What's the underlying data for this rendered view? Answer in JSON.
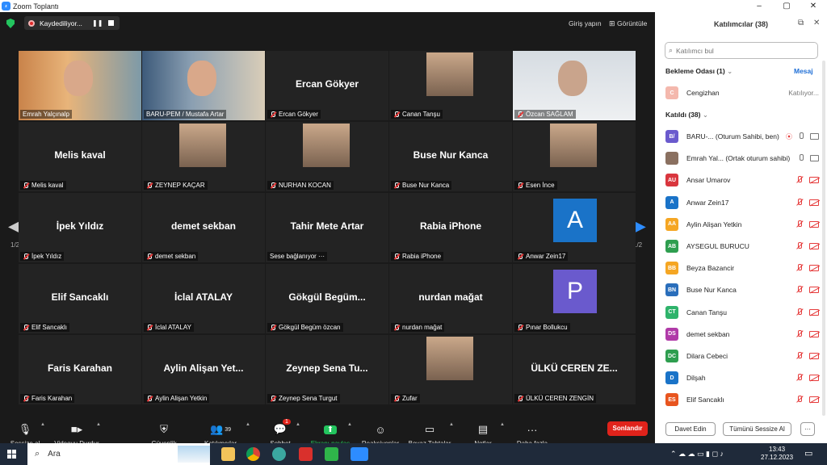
{
  "window": {
    "title": "Zoom Toplantı"
  },
  "meeting": {
    "recording_label": "Kaydediliyor...",
    "signin": "Giriş yapın",
    "view": "Görüntüle",
    "page_left": "1/2",
    "page_right": "1/2"
  },
  "tiles": [
    {
      "name": "Emrah Yalçınalp",
      "big": "",
      "type": "photo",
      "muted": false,
      "active": true
    },
    {
      "name": "BARU-PEM / Mustafa Artar",
      "big": "",
      "type": "photo",
      "muted": false
    },
    {
      "name": "Ercan Gökyer",
      "big": "Ercan Gökyer",
      "type": "name",
      "muted": true
    },
    {
      "name": "Canan Tanşu",
      "big": "",
      "type": "pic",
      "muted": true
    },
    {
      "name": "Özcan SAĞLAM",
      "big": "",
      "type": "photo",
      "muted": true
    },
    {
      "name": "Melis kaval",
      "big": "Melis kaval",
      "type": "name",
      "muted": true
    },
    {
      "name": "ZEYNEP KAÇAR",
      "big": "",
      "type": "pic",
      "muted": true
    },
    {
      "name": "NURHAN KOCAN",
      "big": "",
      "type": "pic",
      "muted": true
    },
    {
      "name": "Buse Nur Kanca",
      "big": "Buse Nur Kanca",
      "type": "name",
      "muted": true
    },
    {
      "name": "Esen İnce",
      "big": "",
      "type": "pic",
      "muted": true
    },
    {
      "name": "İpek Yıldız",
      "big": "İpek Yıldız",
      "type": "name",
      "muted": true
    },
    {
      "name": "demet sekban",
      "big": "demet sekban",
      "type": "name",
      "muted": true
    },
    {
      "name": "Sese bağlanıyor ···",
      "big": "Tahir Mete Artar",
      "type": "name",
      "muted": false
    },
    {
      "name": "Rabia iPhone",
      "big": "Rabia iPhone",
      "type": "name",
      "muted": true
    },
    {
      "name": "Anwar Zein17",
      "big": "A",
      "type": "avatar",
      "muted": true,
      "color": "#1a73c8"
    },
    {
      "name": "Elif Sancaklı",
      "big": "Elif Sancaklı",
      "type": "name",
      "muted": true
    },
    {
      "name": "İclal ATALAY",
      "big": "İclal ATALAY",
      "type": "name",
      "muted": true
    },
    {
      "name": "Gökgül Begüm özcan",
      "big": "Gökgül Begüm...",
      "type": "name",
      "muted": true
    },
    {
      "name": "nurdan mağat",
      "big": "nurdan mağat",
      "type": "name",
      "muted": true
    },
    {
      "name": "Pınar Bollukcu",
      "big": "P",
      "type": "avatar",
      "muted": true,
      "color": "#6a5acd"
    },
    {
      "name": "Faris Karahan",
      "big": "Faris Karahan",
      "type": "name",
      "muted": true
    },
    {
      "name": "Aylin Alişan Yetkin",
      "big": "Aylin Alişan Yet...",
      "type": "name",
      "muted": true
    },
    {
      "name": "Zeynep Sena Turgut",
      "big": "Zeynep Sena Tu...",
      "type": "name",
      "muted": true
    },
    {
      "name": "Zufar",
      "big": "",
      "type": "pic",
      "muted": true
    },
    {
      "name": "ÜLKÜ CEREN ZENGİN",
      "big": "ÜLKÜ CEREN ZE...",
      "type": "name",
      "muted": true
    }
  ],
  "toolbar": {
    "mute": "Sessize al",
    "video": "Videoyu Durdur",
    "security": "Güvenlik",
    "participants": "Katılımcılar",
    "participants_count": "39",
    "chat": "Sohbet",
    "chat_badge": "1",
    "share": "Ekranı paylaş",
    "reactions": "Reaksiyonlar",
    "whiteboard": "Beyaz Tahtalar",
    "notes": "Notlar",
    "more": "Daha fazla",
    "end": "Sonlandır"
  },
  "panel": {
    "title": "Katılımcılar (38)",
    "search_placeholder": "Katılımcı bul",
    "waiting_title": "Bekleme Odası (1)",
    "waiting_action": "Mesaj",
    "waiting": [
      {
        "initial": "C",
        "name": "Cengizhan",
        "status": "Katılıyor...",
        "color": "#f4b8ad"
      }
    ],
    "joined_title": "Katıldı (38)",
    "participants": [
      {
        "initial": "B/",
        "name": "BARU-... (Oturum Sahibi, ben)",
        "color": "#6a5acd",
        "muted": false
      },
      {
        "initial": "",
        "name": "Emrah Yal... (Ortak oturum sahibi)",
        "color": "#8a7060",
        "muted": false
      },
      {
        "initial": "AU",
        "name": "Ansar Umarov",
        "color": "#d9363e",
        "muted": true
      },
      {
        "initial": "A",
        "name": "Anwar Zein17",
        "color": "#1a73c8",
        "muted": true
      },
      {
        "initial": "AA",
        "name": "Aylin Alişan Yetkin",
        "color": "#f5a623",
        "muted": true
      },
      {
        "initial": "AB",
        "name": "AYSEGUL BURUCU",
        "color": "#2e9e4f",
        "muted": true
      },
      {
        "initial": "BB",
        "name": "Beyza Bazancir",
        "color": "#f5a623",
        "muted": true
      },
      {
        "initial": "BN",
        "name": "Buse Nur Kanca",
        "color": "#2a6ebb",
        "muted": true
      },
      {
        "initial": "CT",
        "name": "Canan Tanşu",
        "color": "#2fb36b",
        "muted": true
      },
      {
        "initial": "DS",
        "name": "demet sekban",
        "color": "#b03aa8",
        "muted": true
      },
      {
        "initial": "DC",
        "name": "Dilara Cebeci",
        "color": "#2e9e4f",
        "muted": true
      },
      {
        "initial": "D",
        "name": "Dilşah",
        "color": "#1a73c8",
        "muted": true
      },
      {
        "initial": "ES",
        "name": "Elif Sancaklı",
        "color": "#e8551f",
        "muted": true
      }
    ],
    "invite": "Davet Edin",
    "mute_all": "Tümünü Sessize Al",
    "more": "···"
  },
  "taskbar": {
    "search": "Ara",
    "time": "13:43",
    "date": "27.12.2023"
  }
}
